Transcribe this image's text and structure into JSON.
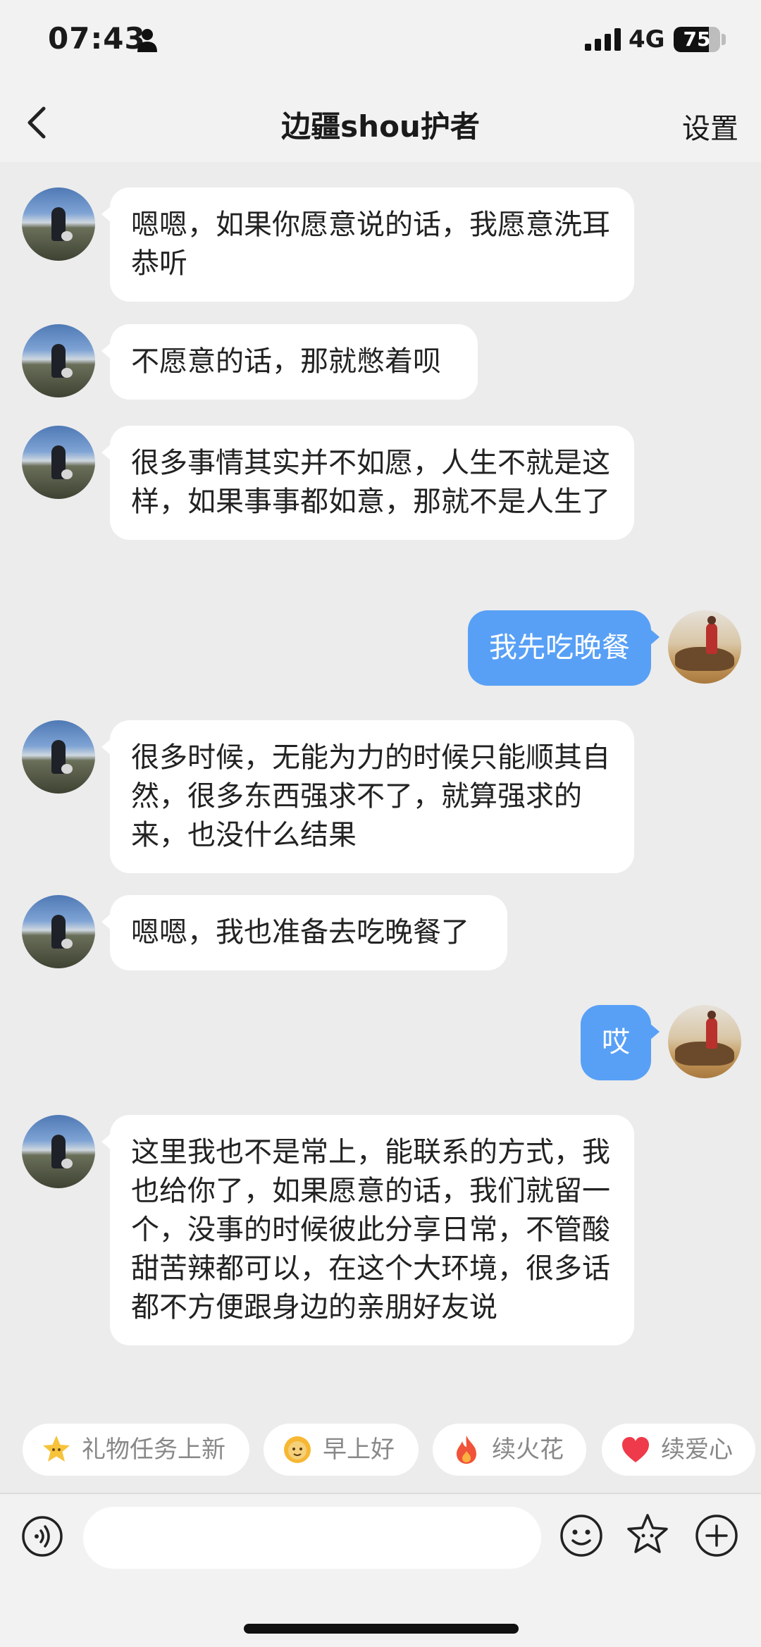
{
  "status": {
    "time": "07:43",
    "network": "4G",
    "battery": "75",
    "battery_level": 0.75
  },
  "header": {
    "title": "边疆shou护者",
    "settings_label": "设置"
  },
  "messages": [
    {
      "from": "them",
      "text": "嗯嗯，如果你愿意说的话，我愿意洗耳恭听"
    },
    {
      "from": "them",
      "text": "不愿意的话，那就憋着呗"
    },
    {
      "from": "them",
      "text": "很多事情其实并不如愿，人生不就是这样，如果事事都如意，那就不是人生了"
    },
    {
      "from": "me",
      "text": "我先吃晚餐"
    },
    {
      "from": "them",
      "text": "很多时候，无能为力的时候只能顺其自然，很多东西强求不了，就算强求的来，也没什么结果"
    },
    {
      "from": "them",
      "text": "嗯嗯，我也准备去吃晚餐了"
    },
    {
      "from": "me",
      "text": "哎"
    },
    {
      "from": "them",
      "text": "这里我也不是常上，能联系的方式，我也给你了，如果愿意的话，我们就留一个，没事的时候彼此分享日常，不管酸甜苦辣都可以，在这个大环境，很多话都不方便跟身边的亲朋好友说"
    }
  ],
  "quick_actions": [
    {
      "label": "礼物任务上新",
      "icon": "star-face-icon"
    },
    {
      "label": "早上好",
      "icon": "sun-face-icon"
    },
    {
      "label": "续火花",
      "icon": "fire-icon"
    },
    {
      "label": "续爱心",
      "icon": "heart-icon"
    }
  ],
  "input": {
    "placeholder": ""
  },
  "colors": {
    "my_bubble": "#58a0f6",
    "their_bubble": "#ffffff",
    "background": "#ececec"
  }
}
